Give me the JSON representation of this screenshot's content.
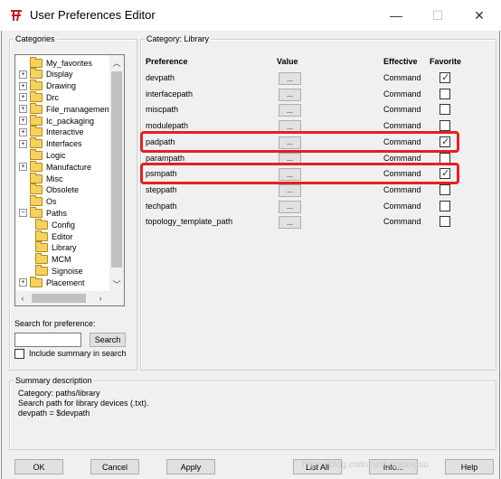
{
  "window": {
    "title": "User Preferences Editor",
    "minimize_glyph": "—",
    "maximize_glyph": "☐",
    "close_glyph": "✕"
  },
  "categories": {
    "label": "Categories",
    "items": [
      {
        "label": "My_favorites",
        "expandable": false,
        "indent": 0
      },
      {
        "label": "Display",
        "expandable": true,
        "indent": 0
      },
      {
        "label": "Drawing",
        "expandable": true,
        "indent": 0
      },
      {
        "label": "Drc",
        "expandable": true,
        "indent": 0
      },
      {
        "label": "File_management",
        "expandable": true,
        "indent": 0
      },
      {
        "label": "Ic_packaging",
        "expandable": true,
        "indent": 0
      },
      {
        "label": "Interactive",
        "expandable": true,
        "indent": 0
      },
      {
        "label": "Interfaces",
        "expandable": true,
        "indent": 0
      },
      {
        "label": "Logic",
        "expandable": false,
        "indent": 0
      },
      {
        "label": "Manufacture",
        "expandable": true,
        "indent": 0
      },
      {
        "label": "Misc",
        "expandable": false,
        "indent": 0
      },
      {
        "label": "Obsolete",
        "expandable": false,
        "indent": 0
      },
      {
        "label": "Os",
        "expandable": false,
        "indent": 0
      },
      {
        "label": "Paths",
        "expandable": true,
        "expanded": true,
        "indent": 0
      },
      {
        "label": "Config",
        "expandable": false,
        "indent": 1
      },
      {
        "label": "Editor",
        "expandable": false,
        "indent": 1
      },
      {
        "label": "Library",
        "expandable": false,
        "indent": 1,
        "selected": true
      },
      {
        "label": "MCM",
        "expandable": false,
        "indent": 1
      },
      {
        "label": "Signoise",
        "expandable": false,
        "indent": 1
      },
      {
        "label": "Placement",
        "expandable": true,
        "indent": 0
      }
    ]
  },
  "search": {
    "label": "Search for preference:",
    "value": "",
    "button": "Search",
    "include_summary_label": "Include summary in search",
    "include_summary_checked": false
  },
  "category_panel": {
    "label": "Category:  Library",
    "headers": {
      "preference": "Preference",
      "value": "Value",
      "effective": "Effective",
      "favorite": "Favorite"
    },
    "rows": [
      {
        "name": "devpath",
        "value_btn": "...",
        "effective": "Command",
        "favorite": true,
        "highlighted": false
      },
      {
        "name": "interfacepath",
        "value_btn": "...",
        "effective": "Command",
        "favorite": false,
        "highlighted": false
      },
      {
        "name": "miscpath",
        "value_btn": "...",
        "effective": "Command",
        "favorite": false,
        "highlighted": false
      },
      {
        "name": "modulepath",
        "value_btn": "...",
        "effective": "Command",
        "favorite": false,
        "highlighted": false
      },
      {
        "name": "padpath",
        "value_btn": "...",
        "effective": "Command",
        "favorite": true,
        "highlighted": true
      },
      {
        "name": "parampath",
        "value_btn": "...",
        "effective": "Command",
        "favorite": false,
        "highlighted": false
      },
      {
        "name": "psmpath",
        "value_btn": "...",
        "effective": "Command",
        "favorite": true,
        "highlighted": true
      },
      {
        "name": "steppath",
        "value_btn": "...",
        "effective": "Command",
        "favorite": false,
        "highlighted": false
      },
      {
        "name": "techpath",
        "value_btn": "...",
        "effective": "Command",
        "favorite": false,
        "highlighted": false
      },
      {
        "name": "topology_template_path",
        "value_btn": "...",
        "effective": "Command",
        "favorite": false,
        "highlighted": false
      }
    ]
  },
  "summary": {
    "label": "Summary description",
    "lines": [
      "Category: paths/library",
      "Search path for library devices (.txt).",
      "devpath = $devpath"
    ]
  },
  "footer": {
    "ok": "OK",
    "cancel": "Cancel",
    "apply": "Apply",
    "list_all": "List All",
    "info": "Info...",
    "help": "Help",
    "watermark": "https://blog.csdn.net/ysgjiangsu"
  },
  "colors": {
    "highlight": "#e62020",
    "selected_bg": "#0078d7"
  }
}
